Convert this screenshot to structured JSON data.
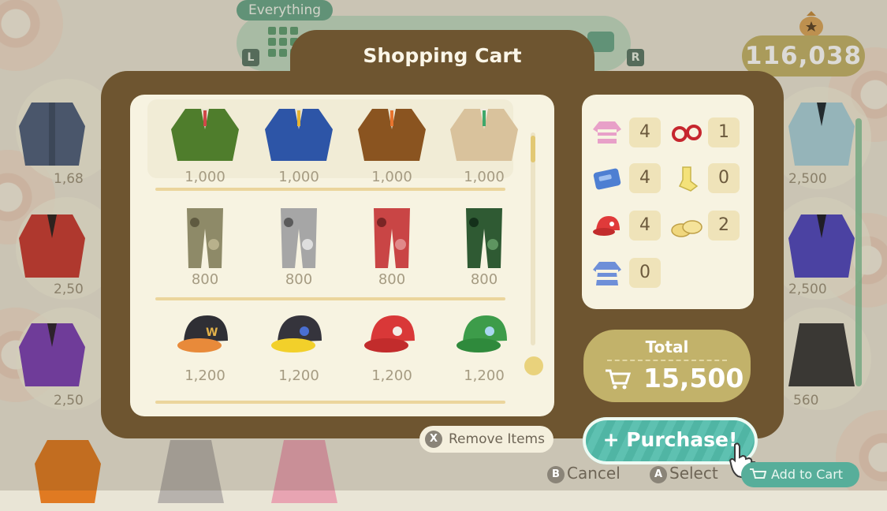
{
  "hud": {
    "category_tab": "Everything",
    "l_button": "L",
    "r_button": "R",
    "bells_balance": "116,038"
  },
  "background_prices": {
    "left": [
      "1,68",
      "2,50",
      "2,50"
    ],
    "right": [
      "2,500",
      "2,500",
      "560"
    ]
  },
  "dialog": {
    "title": "Shopping Cart",
    "items": [
      {
        "icon": "green-plaid-jacket-icon",
        "price": "1,000",
        "color": "#4f7d2c"
      },
      {
        "icon": "blue-plaid-jacket-icon",
        "price": "1,000",
        "color": "#2d55a7"
      },
      {
        "icon": "brown-plaid-jacket-icon",
        "price": "1,000",
        "color": "#8a5420"
      },
      {
        "icon": "beige-plaid-jacket-icon",
        "price": "1,000",
        "color": "#d9c29c"
      },
      {
        "icon": "beige-camo-pants-icon",
        "price": "800",
        "color": "#8e8a68"
      },
      {
        "icon": "gray-camo-pants-icon",
        "price": "800",
        "color": "#a6a6a6"
      },
      {
        "icon": "red-camo-pants-icon",
        "price": "800",
        "color": "#c94545"
      },
      {
        "icon": "green-camo-pants-icon",
        "price": "800",
        "color": "#2f5a33"
      },
      {
        "icon": "black-cap-orange-icon",
        "price": "1,200",
        "color": "#2f2f35"
      },
      {
        "icon": "black-cap-yellow-icon",
        "price": "1,200",
        "color": "#35343c"
      },
      {
        "icon": "red-cap-icon",
        "price": "1,200",
        "color": "#d93838"
      },
      {
        "icon": "green-cap-icon",
        "price": "1,200",
        "color": "#3d9c4a"
      }
    ],
    "summary": [
      {
        "icon": "tops-icon",
        "count": "4"
      },
      {
        "icon": "glasses-icon",
        "count": "1"
      },
      {
        "icon": "bottoms-icon",
        "count": "4"
      },
      {
        "icon": "socks-icon",
        "count": "0"
      },
      {
        "icon": "caps-icon",
        "count": "4"
      },
      {
        "icon": "shoes-icon",
        "count": "2"
      },
      {
        "icon": "dress-icon",
        "count": "0"
      }
    ],
    "total_label": "Total",
    "total_value": "15,500"
  },
  "controls": {
    "remove_key": "X",
    "remove_label": "Remove Items",
    "purchase_label": "+ Purchase!",
    "cancel_key": "B",
    "cancel_label": "Cancel",
    "select_key": "A",
    "select_label": "Select",
    "add_to_cart_label": "Add to Cart"
  },
  "colors": {
    "dialog_brown": "#6e5530",
    "panel_cream": "#f7f3e1",
    "total_gold": "#c2b26a",
    "purchase_teal": "#5ec1b1"
  }
}
